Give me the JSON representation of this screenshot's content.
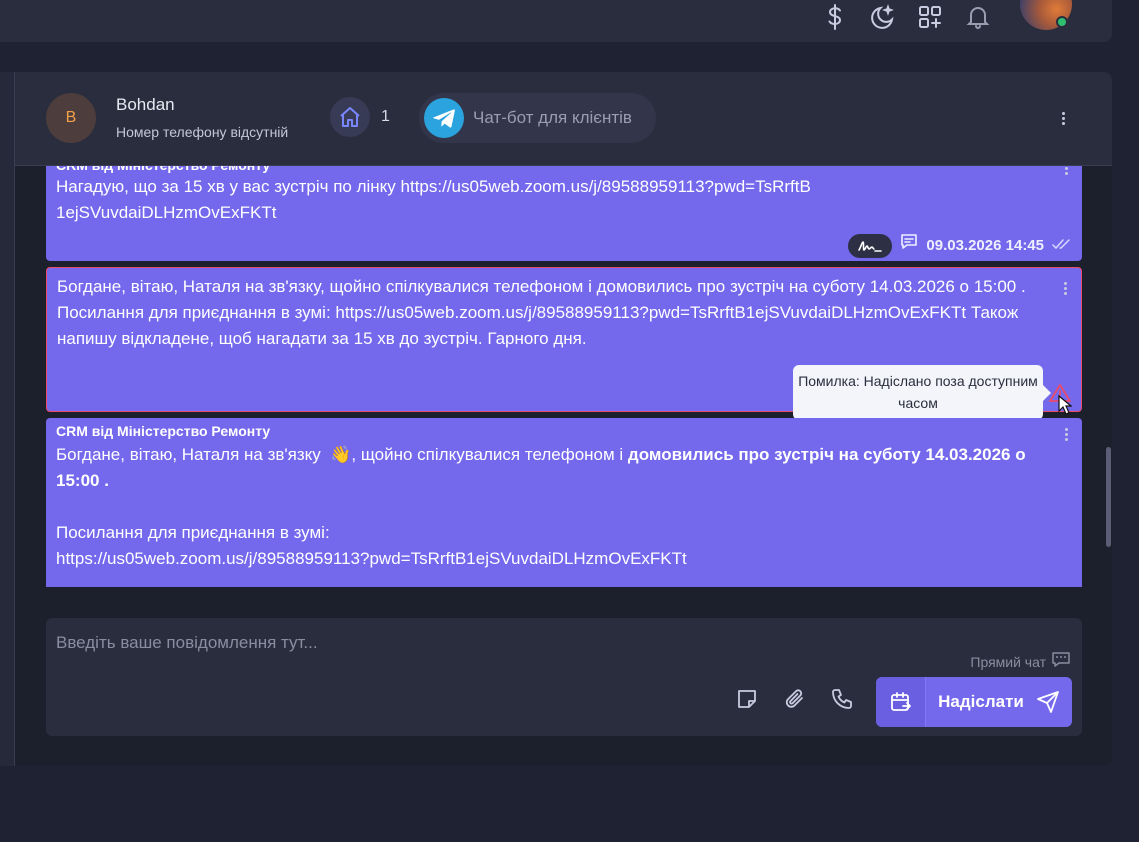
{
  "topbar": {
    "icons": [
      "dollar-icon",
      "moon-icon",
      "apps-add-icon",
      "bell-icon"
    ],
    "user_avatar": "user-avatar",
    "status_color": "#2fbf71"
  },
  "contact": {
    "initial": "B",
    "name": "Bohdan",
    "phone_status": "Номер телефону відсутній",
    "home_count": "1",
    "bot_channel": "Чат-бот для клієнтів"
  },
  "messages": [
    {
      "sender": "CRM від Міністерство Ремонту",
      "text": "Нагадую, що за 15 хв у вас зустріч по лінку https://us05web.zoom.us/j/89588959113?pwd=TsRrftB1ejSVuvdaiDLHzmOvExFKTt",
      "timestamp": "09.03.2026 14:45"
    },
    {
      "text": "Богдане, вітаю, Наталя на зв'язку, щойно спілкувалися телефоном і домовились про зустріч на суботу 14.03.2026 о 15:00 . Посилання для приєднання в зумі: https://us05web.zoom.us/j/89588959113?pwd=TsRrftB1ejSVuvdaiDLHzmOvExFKTt Також напишу відкладене, щоб нагадати за 15 хв до зустріч. Гарного дня.",
      "error_tooltip": "Помилка: Надіслано поза доступним часом",
      "status": "error",
      "error_color": "#ea4a6b"
    },
    {
      "sender": "CRM від Міністерство Ремонту",
      "text_part1": "Богдане, вітаю, Наталя на зв'язку",
      "emoji": "👋",
      "text_part2": ", щойно спілкувалися телефоном і ",
      "text_bold": "домовились про зустріч на суботу 14.03.2026 о 15:00 .",
      "link_label": "Посилання для приєднання в зумі:",
      "link": "https://us05web.zoom.us/j/89588959113?pwd=TsRrftB1ejSVuvdaiDLHzmOvExFKTt"
    }
  ],
  "composer": {
    "placeholder": "Введіть ваше повідомлення тут...",
    "direct_chat_label": "Прямий чат",
    "send_label": "Надіслати"
  },
  "colors": {
    "accent": "#7468ec",
    "panel": "#2a2d3e",
    "background": "#1f2232"
  }
}
